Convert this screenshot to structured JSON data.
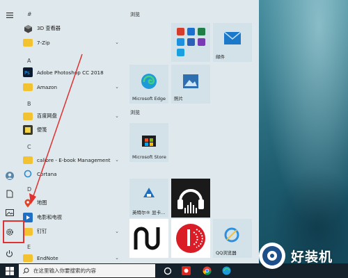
{
  "colors": {
    "accent_red": "#e03030",
    "folder": "#f3c230"
  },
  "rail": {
    "hamburger_icon": "hamburger-icon",
    "items": [
      "avatar",
      "document-icon",
      "picture-icon",
      "settings-icon",
      "power-icon"
    ]
  },
  "applist": {
    "sections": [
      {
        "letter": "#",
        "apps": [
          {
            "label": "3D 查看器",
            "icon": "cube-icon"
          },
          {
            "label": "7-Zip",
            "icon": "folder-icon",
            "expandable": true
          }
        ]
      },
      {
        "letter": "A",
        "apps": [
          {
            "label": "Adobe Photoshop CC 2018",
            "icon": "photoshop-icon"
          },
          {
            "label": "Amazon",
            "icon": "folder-icon",
            "expandable": true
          }
        ]
      },
      {
        "letter": "B",
        "apps": [
          {
            "label": "百度网盘",
            "icon": "folder-icon",
            "expandable": true
          },
          {
            "label": "便笺",
            "icon": "sticky-note-icon"
          }
        ]
      },
      {
        "letter": "C",
        "apps": [
          {
            "label": "calibre - E-book Management",
            "icon": "folder-icon",
            "expandable": true
          },
          {
            "label": "Cortana",
            "icon": "cortana-icon"
          }
        ]
      },
      {
        "letter": "D",
        "apps": [
          {
            "label": "地图",
            "icon": "map-pin-icon"
          },
          {
            "label": "电影和电视",
            "icon": "film-icon"
          },
          {
            "label": "钉钉",
            "icon": "folder-icon",
            "expandable": true
          }
        ]
      },
      {
        "letter": "E",
        "apps": [
          {
            "label": "EndNote",
            "icon": "folder-icon",
            "expandable": true
          }
        ]
      }
    ]
  },
  "tiles": {
    "group1_title": "浏览",
    "mail_label": "邮件",
    "edge_label": "Microsoft Edge",
    "photos_label": "照片",
    "group2_title": "浏览",
    "store_label": "Microsoft Store",
    "nvidia_label": "英特尔® 显卡...",
    "qq_browser_label": "QQ浏览器"
  },
  "taskbar": {
    "search_placeholder": "在这里输入你要搜索的内容",
    "icons": [
      "windows-icon",
      "search-icon",
      "task-view-icon",
      "jd-icon",
      "chrome-icon",
      "edge-icon"
    ]
  },
  "watermark": {
    "text": "好装机"
  }
}
